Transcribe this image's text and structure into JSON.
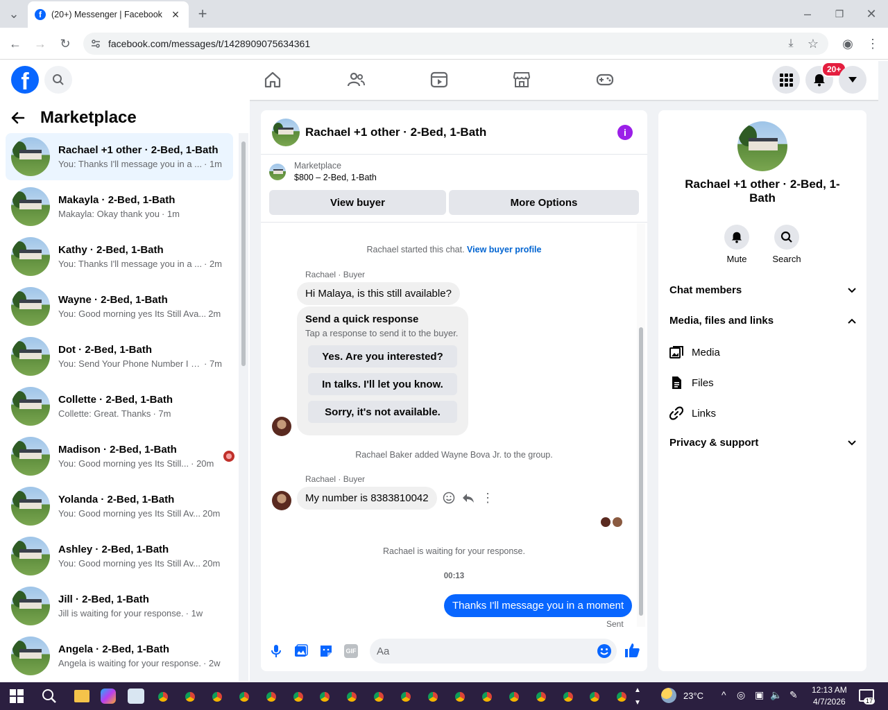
{
  "browser": {
    "tab_title": "(20+) Messenger | Facebook",
    "url": "facebook.com/messages/t/1428909075634361",
    "tab_favicon": "f"
  },
  "fb": {
    "logo": "f",
    "notif_badge": "20+"
  },
  "left": {
    "title": "Marketplace",
    "conversations": [
      {
        "name": "Rachael +1 other · 2-Bed, 1-Bath",
        "preview": "You: Thanks I'll message you in a ...",
        "time": "· 1m",
        "selected": true
      },
      {
        "name": "Makayla · 2-Bed, 1-Bath",
        "preview": "Makayla: Okay thank you",
        "time": "· 1m"
      },
      {
        "name": "Kathy · 2-Bed, 1-Bath",
        "preview": "You: Thanks I'll message you in a ...",
        "time": "· 2m"
      },
      {
        "name": "Wayne · 2-Bed, 1-Bath",
        "preview": "You: Good morning yes Its Still Ava...",
        "time": "2m"
      },
      {
        "name": "Dot · 2-Bed, 1-Bath",
        "preview": "You: Send Your Phone Number I W...",
        "time": "· 7m"
      },
      {
        "name": "Collette · 2-Bed, 1-Bath",
        "preview": "Collette: Great. Thanks",
        "time": "· 7m"
      },
      {
        "name": "Madison · 2-Bed, 1-Bath",
        "preview": "You: Good morning yes Its Still...",
        "time": "· 20m"
      },
      {
        "name": "Yolanda · 2-Bed, 1-Bath",
        "preview": "You: Good morning yes Its Still Av...",
        "time": "20m"
      },
      {
        "name": "Ashley · 2-Bed, 1-Bath",
        "preview": "You: Good morning yes Its Still Av...",
        "time": "20m"
      },
      {
        "name": "Jill · 2-Bed, 1-Bath",
        "preview": "Jill is waiting for your response.",
        "time": "· 1w"
      },
      {
        "name": "Angela · 2-Bed, 1-Bath",
        "preview": "Angela is waiting for your response.",
        "time": "· 2w"
      }
    ]
  },
  "chat": {
    "title": "Rachael +1 other · 2-Bed, 1-Bath",
    "listing_label": "Marketplace",
    "listing_price": "$800 – 2-Bed, 1-Bath",
    "view_buyer": "View buyer",
    "more_options": "More Options",
    "started": "Rachael started this chat.",
    "view_profile": "View buyer profile",
    "sender1": "Rachael · Buyer",
    "msg1": "Hi Malaya, is this still available?",
    "qr_title": "Send a quick response",
    "qr_sub": "Tap a response to send it to the buyer.",
    "qr_options": [
      "Yes. Are you interested?",
      "In talks. I'll let you know.",
      "Sorry, it's not available."
    ],
    "added": "Rachael Baker added Wayne Bova Jr. to the group.",
    "sender2": "Rachael · Buyer",
    "msg2": "My number is 8383810042",
    "waiting": "Rachael is waiting for your response.",
    "time": "00:13",
    "sent_msg": "Thanks I'll message you in a moment",
    "sent_status": "Sent",
    "input_placeholder": "Aa"
  },
  "right": {
    "name": "Rachael +1 other · 2-Bed, 1-Bath",
    "mute": "Mute",
    "search": "Search",
    "chat_members": "Chat members",
    "media_files_links": "Media, files and links",
    "media": "Media",
    "files": "Files",
    "links": "Links",
    "privacy": "Privacy & support"
  },
  "taskbar": {
    "weather": "23°C",
    "time": "12:13 AM",
    "date": "4/7/2026",
    "notif_count": "17"
  }
}
